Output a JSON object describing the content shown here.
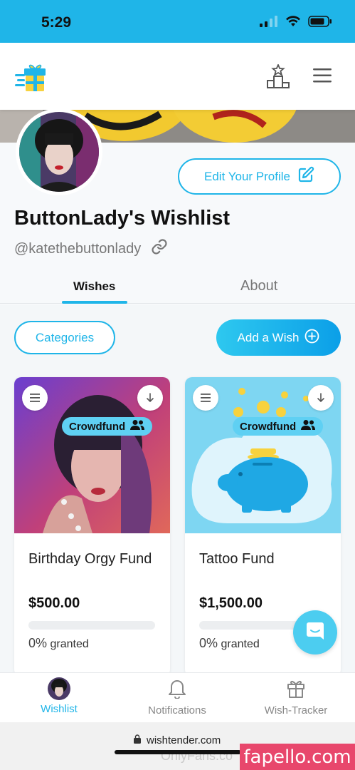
{
  "status_bar": {
    "time": "5:29",
    "background": "#1fb5e8"
  },
  "header": {
    "logo_icon": "gift-icon",
    "leaderboard_icon": "podium-icon",
    "menu_icon": "hamburger-icon"
  },
  "profile": {
    "edit_label": "Edit Your Profile",
    "title": "ButtonLady's Wishlist",
    "handle": "@katethebuttonlady"
  },
  "tabs": [
    {
      "label": "Wishes",
      "active": true
    },
    {
      "label": "About",
      "active": false
    }
  ],
  "actions": {
    "categories_label": "Categories",
    "add_wish_label": "Add a Wish"
  },
  "wishes": [
    {
      "name": "Birthday Orgy Fund",
      "price": "$500.00",
      "badge": "Crowdfund",
      "percent": "0%",
      "granted_label": "granted",
      "progress": 0
    },
    {
      "name": "Tattoo Fund",
      "price": "$1,500.00",
      "badge": "Crowdfund",
      "percent": "0%",
      "granted_label": "granted",
      "progress": 0
    }
  ],
  "bottom_nav": [
    {
      "label": "Wishlist",
      "active": true
    },
    {
      "label": "Notifications",
      "active": false
    },
    {
      "label": "Wish-Tracker",
      "active": false
    }
  ],
  "browser": {
    "url": "wishtender.com"
  },
  "watermark": {
    "dim": "OnlyFans.co",
    "brand": "fapello.com"
  },
  "colors": {
    "accent": "#1fb5e8",
    "badge": "#5fd0f3"
  }
}
